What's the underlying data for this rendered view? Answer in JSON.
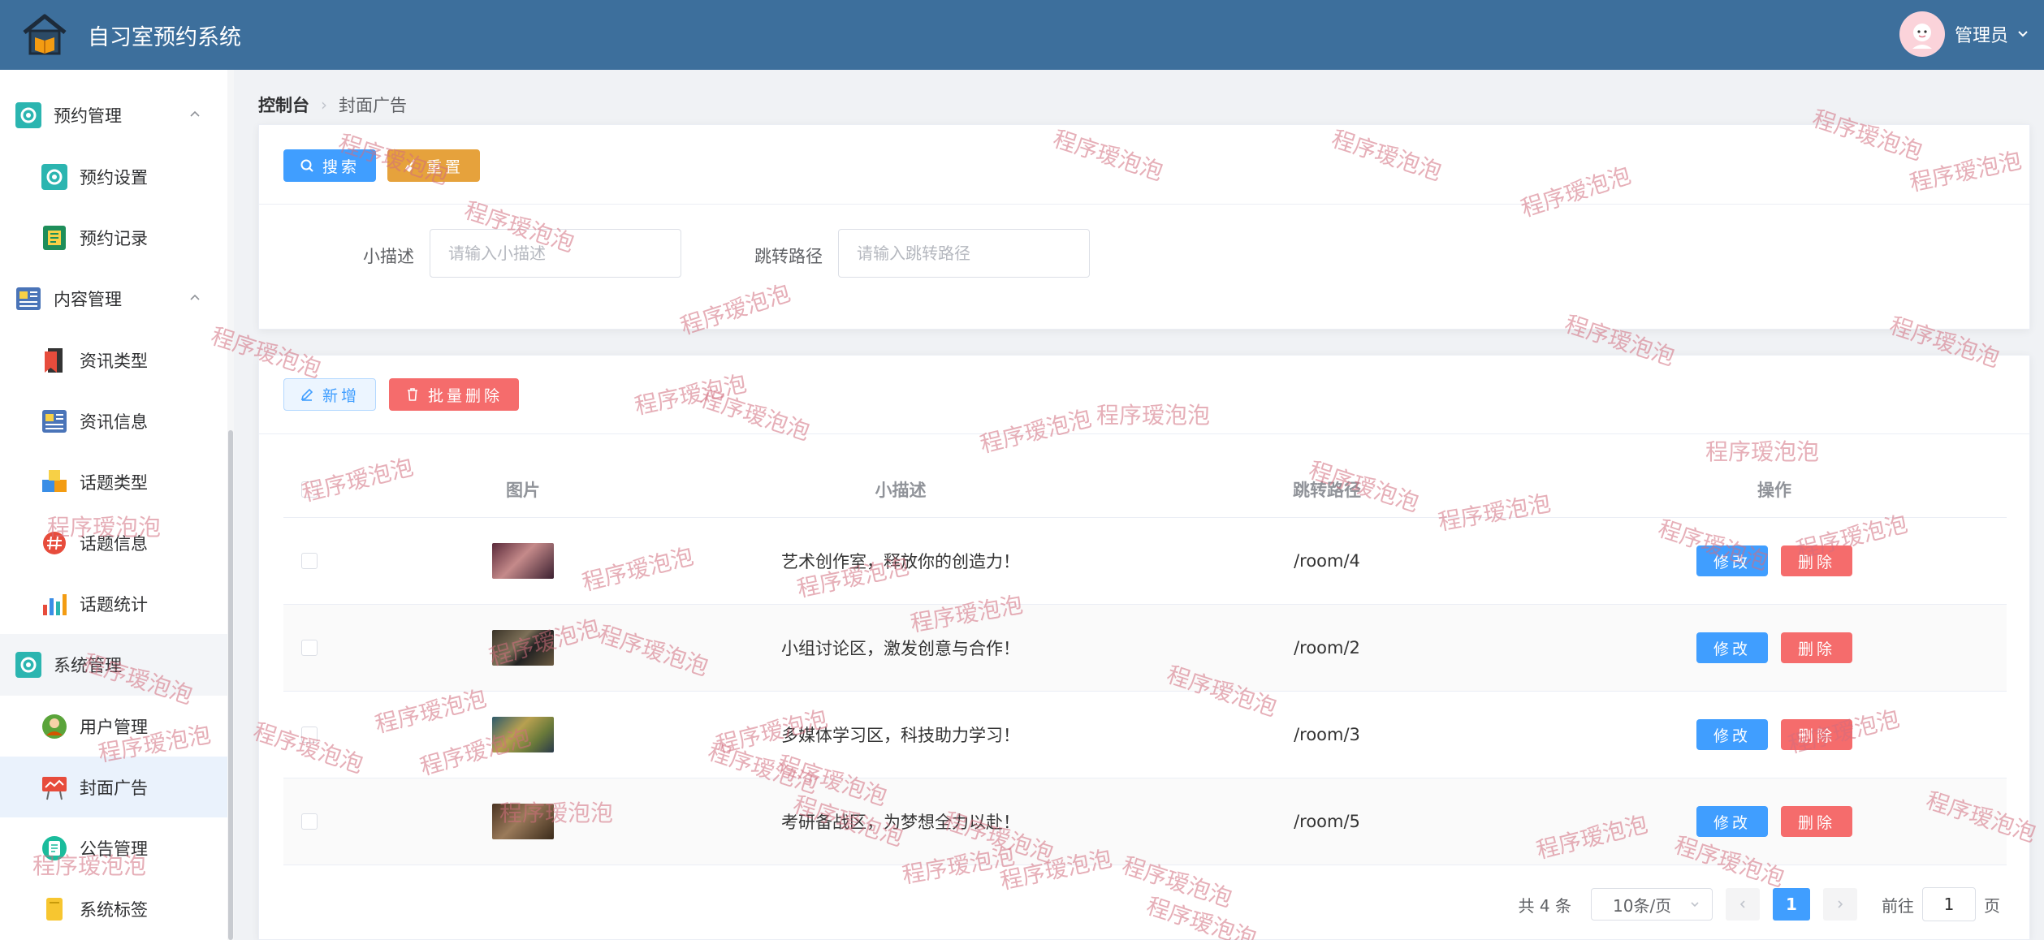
{
  "header": {
    "title": "自习室预约系统",
    "user": "管理员"
  },
  "sidebar": {
    "groups": [
      {
        "label": "预约管理",
        "items": [
          {
            "label": "预约设置"
          },
          {
            "label": "预约记录"
          }
        ]
      },
      {
        "label": "内容管理",
        "items": [
          {
            "label": "资讯类型"
          },
          {
            "label": "资讯信息"
          },
          {
            "label": "话题类型"
          },
          {
            "label": "话题信息"
          },
          {
            "label": "话题统计"
          }
        ]
      },
      {
        "label": "系统管理",
        "items": [
          {
            "label": "用户管理"
          },
          {
            "label": "封面广告"
          },
          {
            "label": "公告管理"
          },
          {
            "label": "系统标签"
          }
        ]
      }
    ]
  },
  "breadcrumb": {
    "home": "控制台",
    "current": "封面广告"
  },
  "search": {
    "search_label": "搜索",
    "reset_label": "重置",
    "desc_label": "小描述",
    "desc_placeholder": "请输入小描述",
    "path_label": "跳转路径",
    "path_placeholder": "请输入跳转路径"
  },
  "toolbar": {
    "add_label": "新增",
    "batch_delete_label": "批量删除"
  },
  "table": {
    "columns": [
      "图片",
      "小描述",
      "跳转路径",
      "操作"
    ],
    "rows": [
      {
        "desc": "艺术创作室，释放你的创造力！",
        "path": "/room/4"
      },
      {
        "desc": "小组讨论区，激发创意与合作！",
        "path": "/room/2"
      },
      {
        "desc": "多媒体学习区，科技助力学习！",
        "path": "/room/3"
      },
      {
        "desc": "考研备战区，为梦想全力以赴！",
        "path": "/room/5"
      }
    ],
    "edit_label": "修改",
    "delete_label": "删除"
  },
  "pagination": {
    "total": "共 4 条",
    "page_size": "10条/页",
    "current_page": "1",
    "goto_prefix": "前往",
    "goto_value": "1",
    "goto_suffix": "页"
  },
  "watermark": "程序瑷泡泡",
  "colors": {
    "header": "#3d6f9c",
    "primary": "#409eff",
    "warning": "#e6a23c",
    "danger": "#f56c6c"
  }
}
